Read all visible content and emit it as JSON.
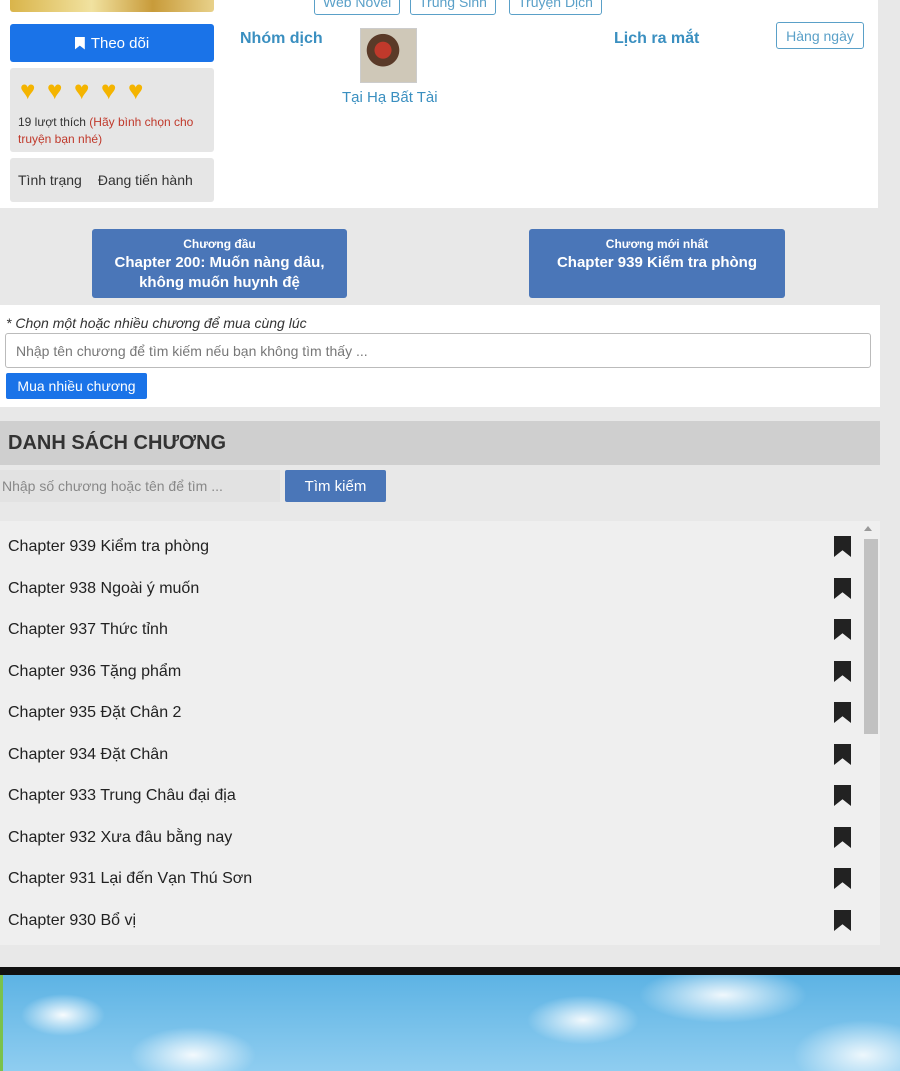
{
  "top": {
    "tags": [
      "Web Novel",
      "Trùng Sinh",
      "Truyện Dịch"
    ],
    "follow_label": "Theo dõi",
    "likes_count": "19 lượt thích",
    "likes_hint": "(Hãy bình chọn cho truyện bạn nhé)",
    "hearts": 5,
    "status_label": "Tình trạng",
    "status_value": "Đang tiến hành",
    "translator_label": "Nhóm dịch",
    "translator_name": "Tại Hạ Bất Tài",
    "schedule_label": "Lịch ra mắt",
    "schedule_value": "Hàng ngày"
  },
  "nav": {
    "first_small": "Chương đầu",
    "first_title": "Chapter 200: Muốn nàng dâu, không muốn huynh đệ",
    "latest_small": "Chương mới nhất",
    "latest_title": "Chapter 939 Kiểm tra phòng"
  },
  "buy": {
    "hint": "* Chọn một hoặc nhiều chương để mua cùng lúc",
    "placeholder": "Nhập tên chương để tìm kiếm nếu bạn không tìm thấy ...",
    "button": "Mua nhiều chương"
  },
  "list": {
    "header": "DANH SÁCH CHƯƠNG",
    "search_placeholder": "Nhập số chương hoặc tên để tìm ...",
    "search_button": "Tìm kiếm",
    "chapters": [
      "Chapter 939 Kiểm tra phòng",
      "Chapter 938 Ngoài ý muốn",
      "Chapter 937 Thức tỉnh",
      "Chapter 936 Tặng phẩm",
      "Chapter 935 Đặt Chân 2",
      "Chapter 934 Đặt Chân",
      "Chapter 933 Trung Châu đại địa",
      "Chapter 932 Xưa đâu bằng nay",
      "Chapter 931 Lại đến Vạn Thú Sơn",
      "Chapter 930 Bổ vị"
    ]
  },
  "colors": {
    "primary": "#1a73e8",
    "nav_button": "#4a76b8",
    "accent_text": "#3a8fc0",
    "heart": "#f4b400"
  },
  "icons": [
    "bookmark-icon",
    "heart-icon",
    "scroll-up-icon"
  ]
}
